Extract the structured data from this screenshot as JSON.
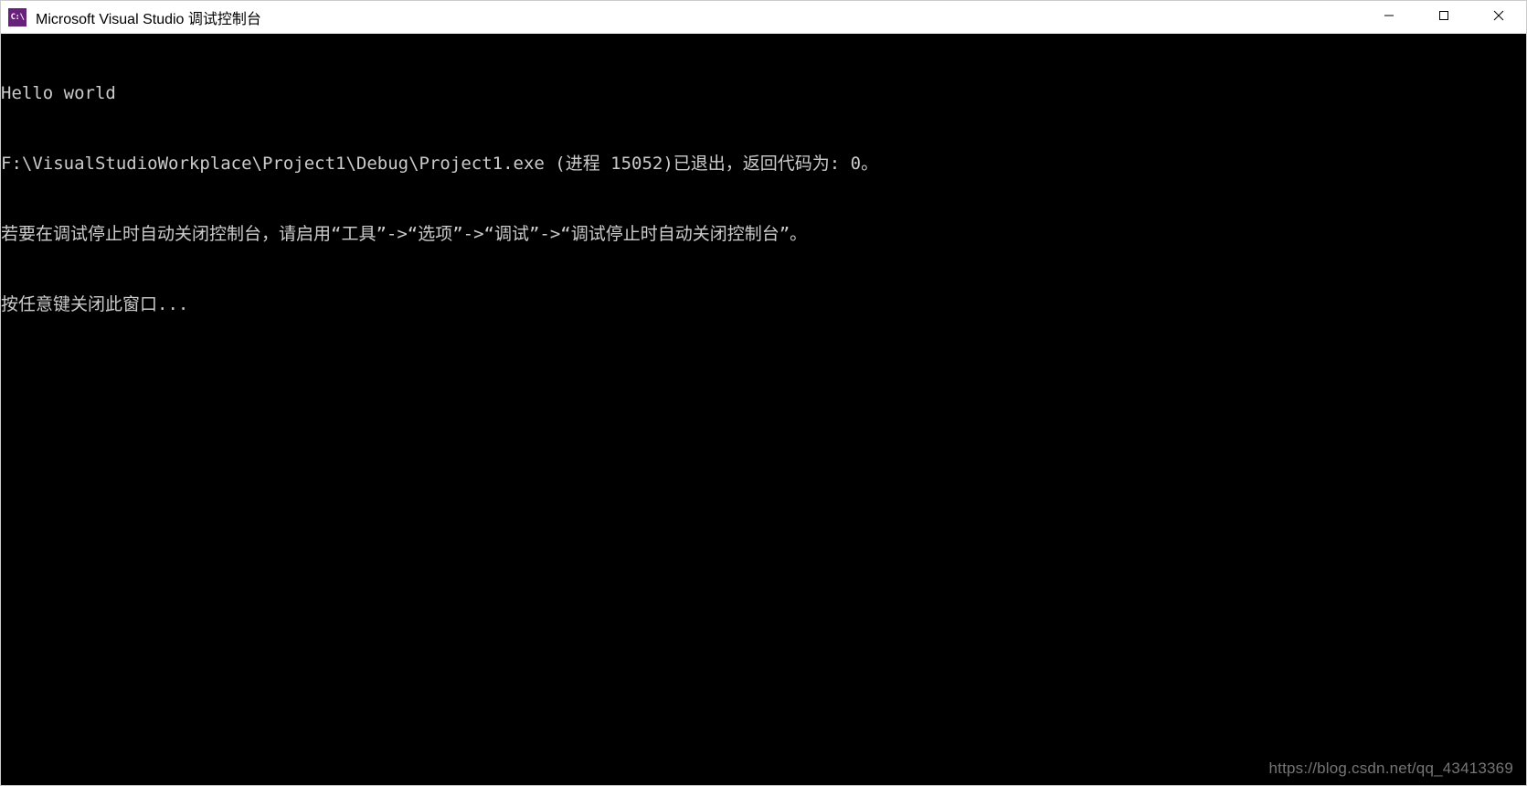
{
  "titlebar": {
    "icon_label": "C:\\",
    "title": "Microsoft Visual Studio 调试控制台"
  },
  "window_controls": {
    "minimize": "minimize",
    "maximize": "maximize",
    "close": "close"
  },
  "console": {
    "lines": [
      "Hello world",
      "F:\\VisualStudioWorkplace\\Project1\\Debug\\Project1.exe (进程 15052)已退出，返回代码为: 0。",
      "若要在调试停止时自动关闭控制台，请启用“工具”->“选项”->“调试”->“调试停止时自动关闭控制台”。",
      "按任意键关闭此窗口..."
    ]
  },
  "watermark": "https://blog.csdn.net/qq_43413369"
}
